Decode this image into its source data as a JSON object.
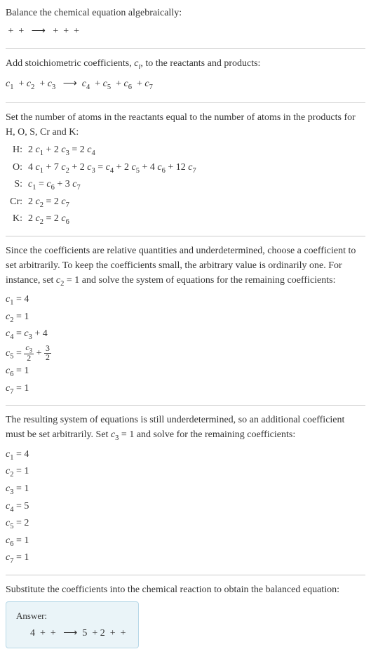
{
  "section1": {
    "line1": "Balance the chemical equation algebraically:",
    "line2": " +  +   ⟶   +  +  + "
  },
  "section2": {
    "line1_pre": "Add stoichiometric coefficients, ",
    "line1_ci": "c",
    "line1_i": "i",
    "line1_post": ", to the reactants and products:",
    "eq_c1": "c",
    "eq_1": "1",
    "eq_c2": "c",
    "eq_2": "2",
    "eq_c3": "c",
    "eq_3": "3",
    "eq_c4": "c",
    "eq_4": "4",
    "eq_c5": "c",
    "eq_5": "5",
    "eq_c6": "c",
    "eq_6": "6",
    "eq_c7": "c",
    "eq_7": "7",
    "plus": "  + ",
    "arrow": "   ⟶  "
  },
  "section3": {
    "intro": "Set the number of atoms in the reactants equal to the number of atoms in the products for H, O, S, Cr and K:",
    "rows": [
      {
        "label": "H:",
        "c": "c",
        "s1": "1",
        "s3": "3",
        "s4": "4",
        "eq": "2 c₁ + 2 c₃ = 2 c₄"
      },
      {
        "label": "O:",
        "eq": "4 c₁ + 7 c₂ + 2 c₃ = c₄ + 2 c₅ + 4 c₆ + 12 c₇"
      },
      {
        "label": "S:",
        "eq": "c₁ = c₆ + 3 c₇"
      },
      {
        "label": "Cr:",
        "eq": "2 c₂ = 2 c₇"
      },
      {
        "label": "K:",
        "eq": "2 c₂ = 2 c₆"
      }
    ]
  },
  "section4": {
    "intro": "Since the coefficients are relative quantities and underdetermined, choose a coefficient to set arbitrarily. To keep the coefficients small, the arbitrary value is ordinarily one. For instance, set c₂ = 1 and solve the system of equations for the remaining coefficients:",
    "rows": [
      "c₁ = 4",
      "c₂ = 1",
      "c₄ = c₃ + 4"
    ],
    "frac_row_pre": "c₅ = ",
    "frac_num": "c₃",
    "frac_den": "2",
    "frac_plus": " + ",
    "frac2_num": "3",
    "frac2_den": "2",
    "rows2": [
      "c₆ = 1",
      "c₇ = 1"
    ]
  },
  "section5": {
    "intro": "The resulting system of equations is still underdetermined, so an additional coefficient must be set arbitrarily. Set c₃ = 1 and solve for the remaining coefficients:",
    "rows": [
      "c₁ = 4",
      "c₂ = 1",
      "c₃ = 1",
      "c₄ = 5",
      "c₅ = 2",
      "c₆ = 1",
      "c₇ = 1"
    ]
  },
  "section6": {
    "intro": "Substitute the coefficients into the chemical reaction to obtain the balanced equation:",
    "answer_label": "Answer:",
    "answer_eq": "4  +  +   ⟶  5  + 2  +  + "
  }
}
